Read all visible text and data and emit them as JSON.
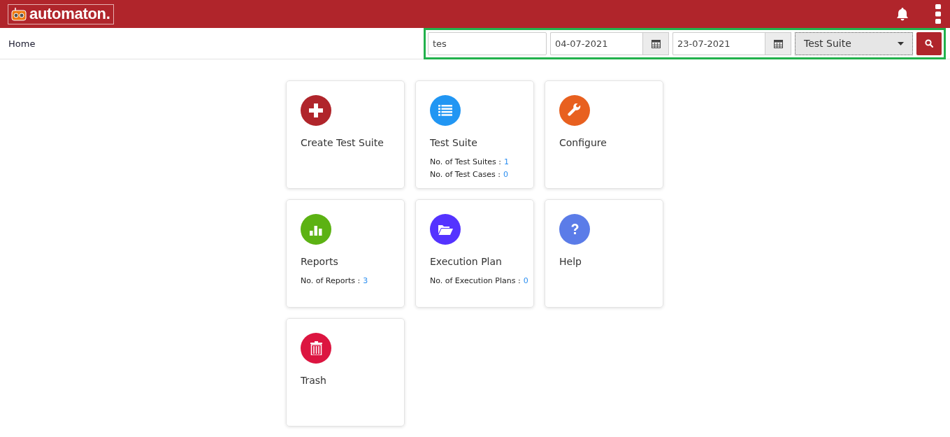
{
  "header": {
    "logo": "automaton."
  },
  "breadcrumb": "Home",
  "filters": {
    "search_value": "tes",
    "date_from": "04-07-2021",
    "date_to": "23-07-2021",
    "type_select": "Test Suite"
  },
  "cards": [
    {
      "title": "Create Test Suite",
      "kind": "plus",
      "color": "#b0252b"
    },
    {
      "title": "Test Suite",
      "kind": "list",
      "color": "#2196f3",
      "stats": [
        {
          "label": "No. of Test Suites :",
          "value": "1"
        },
        {
          "label": "No. of Test Cases :",
          "value": "0"
        }
      ]
    },
    {
      "title": "Configure",
      "kind": "wrench",
      "color": "#e8601f"
    },
    {
      "title": "Reports",
      "kind": "chart",
      "color": "#5cb213",
      "stats": [
        {
          "label": "No. of Reports :",
          "value": "3"
        }
      ]
    },
    {
      "title": "Execution Plan",
      "kind": "folder",
      "color": "#5433ff",
      "stats": [
        {
          "label": "No. of Execution Plans :",
          "value": "0"
        }
      ]
    },
    {
      "title": "Help",
      "kind": "help",
      "color": "#5b7ce8"
    },
    {
      "title": "Trash",
      "kind": "trash",
      "color": "#dc1540"
    }
  ]
}
